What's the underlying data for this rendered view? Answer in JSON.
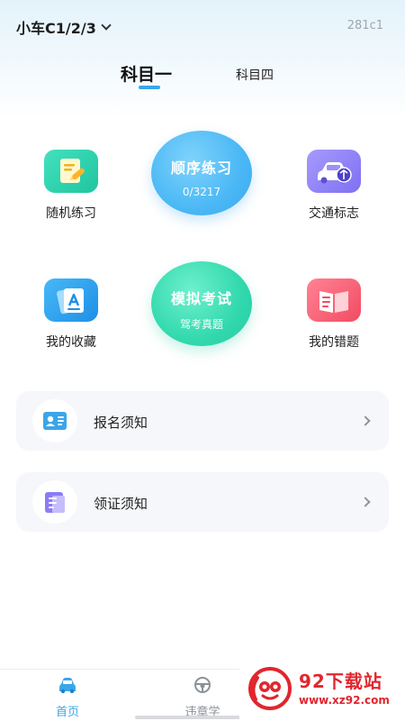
{
  "header": {
    "license_type": "小车C1/2/3",
    "code": "281c1"
  },
  "tabs": [
    {
      "label": "科目一",
      "active": true
    },
    {
      "label": "科目四",
      "active": false
    }
  ],
  "grid": {
    "random_practice": {
      "label": "随机练习",
      "icon": "notepad-pencil-icon"
    },
    "traffic_signs": {
      "label": "交通标志",
      "icon": "car-sign-icon"
    },
    "my_favorites": {
      "label": "我的收藏",
      "icon": "collection-cards-icon"
    },
    "my_mistakes": {
      "label": "我的错题",
      "icon": "open-book-icon"
    }
  },
  "sequential_practice": {
    "title": "顺序练习",
    "progress": "0/3217"
  },
  "mock_exam": {
    "title": "模拟考试",
    "subtitle": "驾考真题"
  },
  "cards": [
    {
      "label": "报名须知",
      "icon": "id-card-icon"
    },
    {
      "label": "领证须知",
      "icon": "document-icon"
    }
  ],
  "bottom_nav": [
    {
      "label": "首页",
      "icon": "car-icon",
      "active": true
    },
    {
      "label": "违章学",
      "icon": "steering-wheel-icon",
      "active": false
    }
  ],
  "watermark": {
    "title": "92下载站",
    "url": "www.xz92.com"
  },
  "colors": {
    "accent": "#3aa6e8",
    "green": "#25cba0",
    "purple": "#7f70f2",
    "red": "#f24b62",
    "watermark_red": "#e0262e"
  }
}
